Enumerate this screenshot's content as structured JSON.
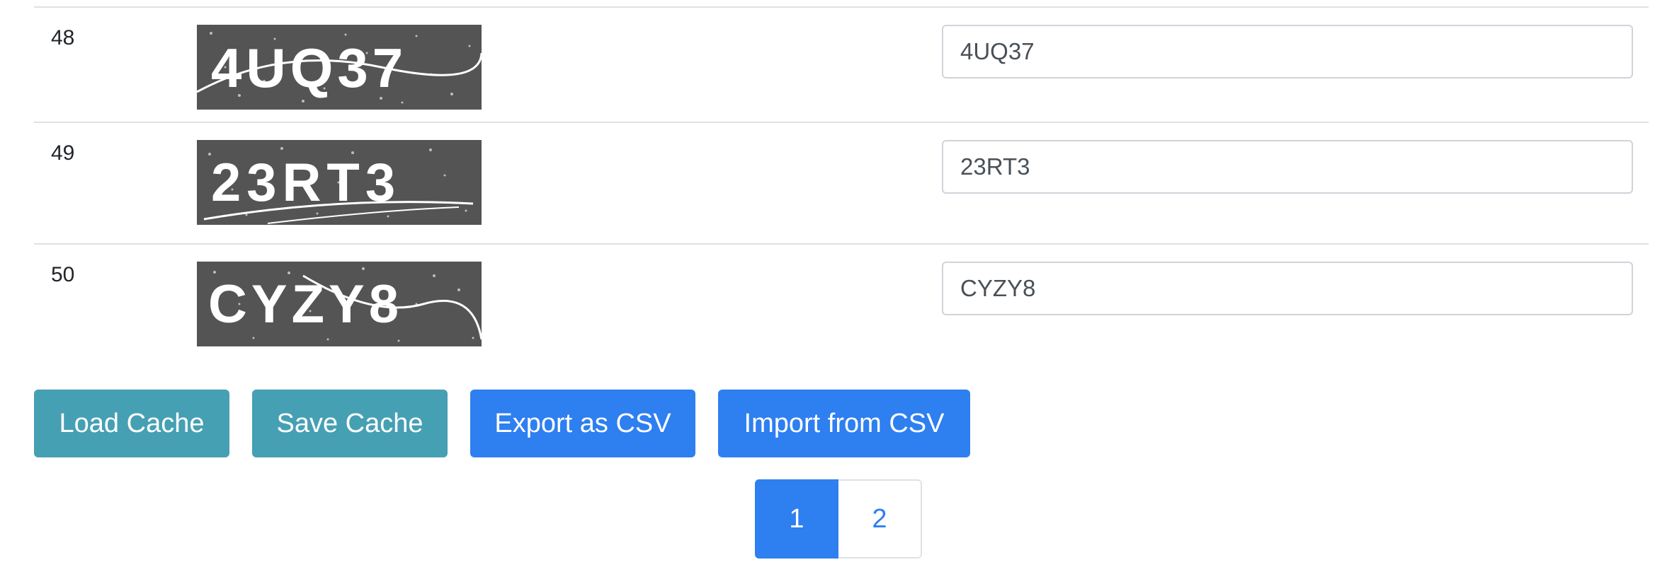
{
  "rows": [
    {
      "index": "48",
      "captcha_text": "4UQ37",
      "answer": "4UQ37"
    },
    {
      "index": "49",
      "captcha_text": "23RT3",
      "answer": "23RT3"
    },
    {
      "index": "50",
      "captcha_text": "CYZY8",
      "answer": "CYZY8"
    }
  ],
  "buttons": {
    "load_cache": "Load Cache",
    "save_cache": "Save Cache",
    "export_csv": "Export as CSV",
    "import_csv": "Import from CSV"
  },
  "pagination": {
    "pages": [
      "1",
      "2"
    ],
    "active": "1"
  },
  "colors": {
    "info": "#46a0b4",
    "primary": "#2e7ff0",
    "captcha_bg": "#545454"
  }
}
